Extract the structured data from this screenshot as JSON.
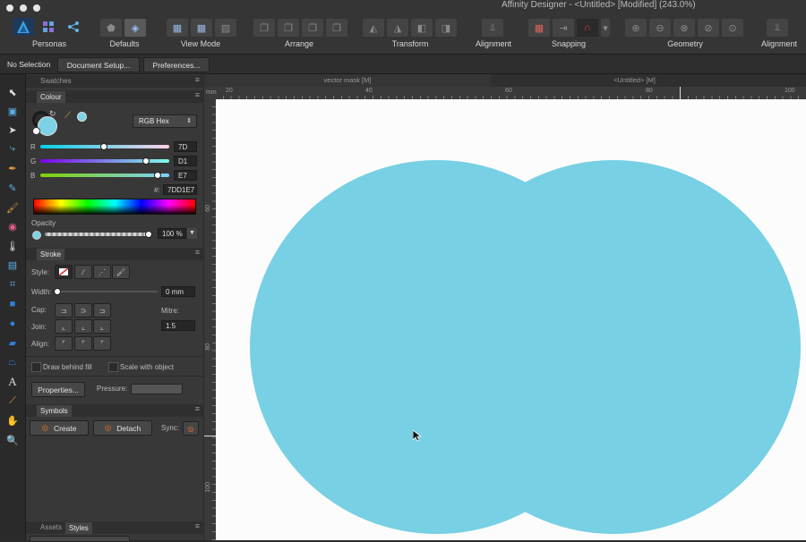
{
  "window": {
    "title": "Affinity Designer - <Untitled> [Modified] (243.0%)"
  },
  "toolbar": {
    "personas_label": "Personas",
    "defaults_label": "Defaults",
    "view_mode_label": "View Mode",
    "arrange_label": "Arrange",
    "transform_label": "Transform",
    "alignment_label": "Alignment",
    "snapping_label": "Snapping",
    "geometry_label": "Geometry",
    "alignment2_label": "Alignment"
  },
  "context": {
    "selection": "No Selection",
    "document_setup": "Document Setup...",
    "preferences": "Preferences..."
  },
  "panels": {
    "swatches_tab": "Swatches",
    "colour_tab": "Colour",
    "stroke_tab": "Stroke",
    "symbols_tab": "Symbols",
    "assets_tab": "Assets",
    "styles_tab": "Styles"
  },
  "colour": {
    "model": "RGB Hex",
    "r_label": "R",
    "r_value": "7D",
    "r_fraction": 0.49,
    "g_label": "G",
    "g_value": "D1",
    "g_fraction": 0.82,
    "b_label": "B",
    "b_value": "E7",
    "b_fraction": 0.91,
    "hex_label": "#:",
    "hex_value": "7DD1E7",
    "opacity_label": "Opacity",
    "opacity_value": "100 %",
    "opacity_fraction": 1.0,
    "fill_color": "#7dd1e7"
  },
  "stroke": {
    "style_label": "Style:",
    "width_label": "Width:",
    "width_value": "0 mm",
    "cap_label": "Cap:",
    "join_label": "Join:",
    "mitre_label": "Mitre:",
    "mitre_value": "1.5",
    "align_label": "Align:",
    "draw_behind_label": "Draw behind fill",
    "scale_label": "Scale with object",
    "properties_label": "Properties...",
    "pressure_label": "Pressure:"
  },
  "symbols": {
    "create_label": "Create",
    "detach_label": "Detach",
    "sync_label": "Sync:"
  },
  "document": {
    "tab1": "vector mask [M]",
    "tab2": "<Untitled> [M]",
    "ruler_unit": "mm",
    "ruler_top": [
      "20",
      "40",
      "60",
      "80",
      "100"
    ],
    "ruler_left": [
      "60",
      "80",
      "100"
    ],
    "shape_color": "#77d0e3"
  }
}
